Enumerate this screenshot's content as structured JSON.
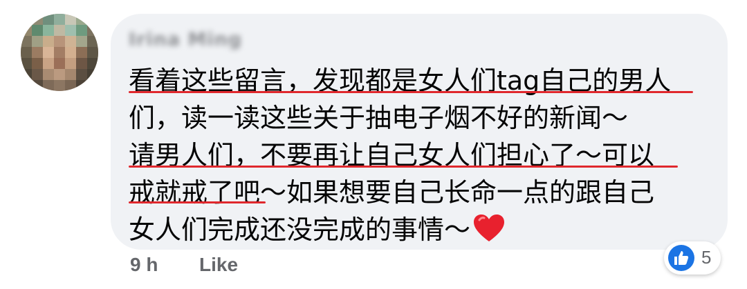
{
  "comment": {
    "author": "Irina Ming",
    "lines": [
      "看着这些留言，发现都是女人们tag自己的男人",
      "们，读一读这些关于抽电子烟不好的新闻～",
      "请男人们，不要再让自己女人们担心了～可以",
      "戒就戒了吧～如果想要自己长命一点的跟自己",
      "女人们完成还没完成的事情～"
    ],
    "emoji": "heart-emoji",
    "underline_color": "#e0282d"
  },
  "footer": {
    "time": "9 h",
    "like_label": "Like"
  },
  "reactions": {
    "icon": "like-icon",
    "count": "5",
    "color": "#1b74e4"
  }
}
